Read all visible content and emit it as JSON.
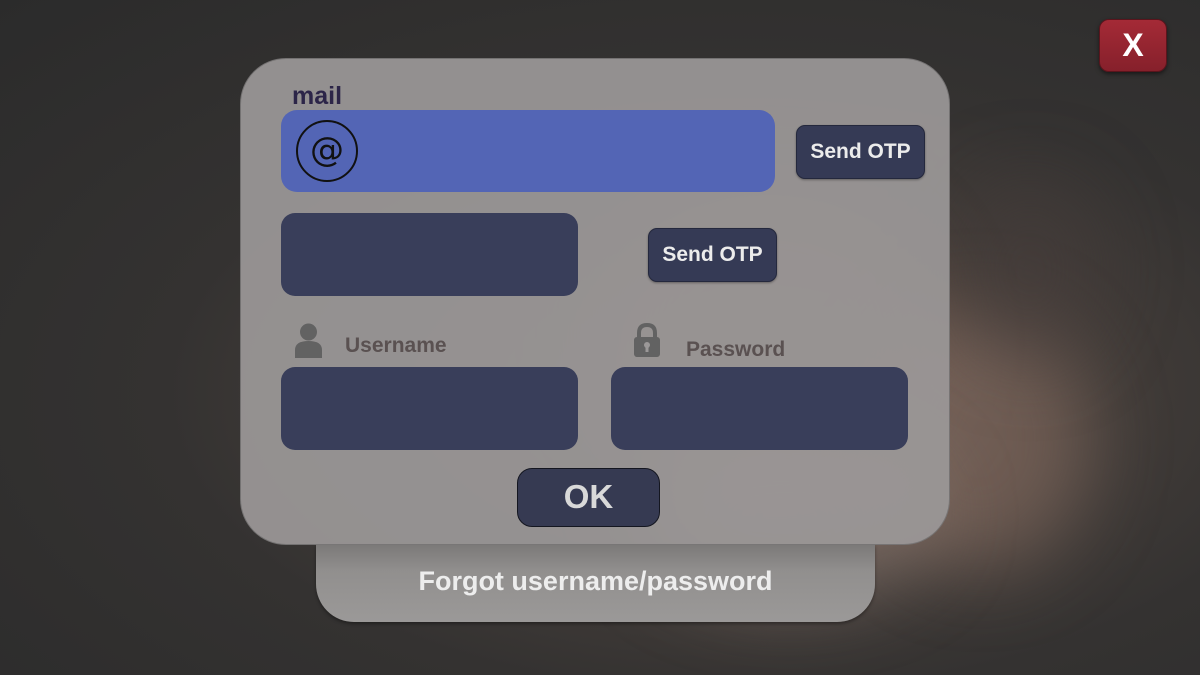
{
  "close_button": {
    "label": "X"
  },
  "mail": {
    "label": "mail",
    "icon_glyph": "@",
    "icon_name": "at-sign-icon",
    "value": "",
    "send_otp_label": "Send OTP"
  },
  "otp": {
    "value": "",
    "send_otp_label": "Send OTP"
  },
  "username": {
    "label": "Username",
    "icon_name": "user-icon",
    "value": ""
  },
  "password": {
    "label": "Password",
    "icon_name": "lock-icon",
    "value": ""
  },
  "ok_button": {
    "label": "OK"
  },
  "forgot_link": {
    "label": "Forgot username/password"
  },
  "colors": {
    "mail_field": "#5365b5",
    "input_field": "#393e5a",
    "button": "#353a55",
    "close_button": "#a42a36",
    "panel": "#9b9898"
  }
}
